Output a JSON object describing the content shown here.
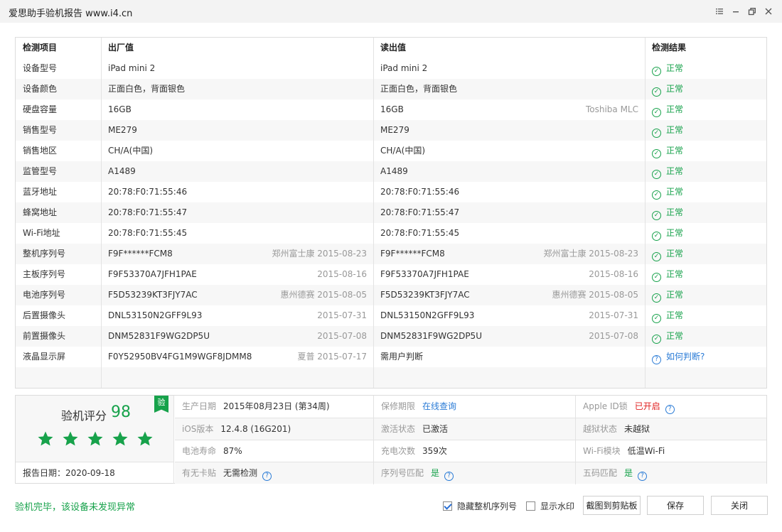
{
  "window": {
    "title": "爱思助手验机报告 www.i4.cn"
  },
  "colors": {
    "ok": "#17a24b",
    "link": "#2a7bd6",
    "alert": "#e02020"
  },
  "table": {
    "headers": [
      "检测项目",
      "出厂值",
      "读出值",
      "检测结果"
    ],
    "rows": [
      {
        "item": "设备型号",
        "factory": "iPad mini 2",
        "factory_note": "",
        "read": "iPad mini 2",
        "read_note": "",
        "result": "正常",
        "status": "ok"
      },
      {
        "item": "设备颜色",
        "factory": "正面白色，背面银色",
        "factory_note": "",
        "read": "正面白色，背面银色",
        "read_note": "",
        "result": "正常",
        "status": "ok"
      },
      {
        "item": "硬盘容量",
        "factory": "16GB",
        "factory_note": "",
        "read": "16GB",
        "read_note": "Toshiba MLC",
        "result": "正常",
        "status": "ok"
      },
      {
        "item": "销售型号",
        "factory": "ME279",
        "factory_note": "",
        "read": "ME279",
        "read_note": "",
        "result": "正常",
        "status": "ok"
      },
      {
        "item": "销售地区",
        "factory": "CH/A(中国)",
        "factory_note": "",
        "read": "CH/A(中国)",
        "read_note": "",
        "result": "正常",
        "status": "ok"
      },
      {
        "item": "监管型号",
        "factory": "A1489",
        "factory_note": "",
        "read": "A1489",
        "read_note": "",
        "result": "正常",
        "status": "ok"
      },
      {
        "item": "蓝牙地址",
        "factory": "20:78:F0:71:55:46",
        "factory_note": "",
        "read": "20:78:F0:71:55:46",
        "read_note": "",
        "result": "正常",
        "status": "ok"
      },
      {
        "item": "蜂窝地址",
        "factory": "20:78:F0:71:55:47",
        "factory_note": "",
        "read": "20:78:F0:71:55:47",
        "read_note": "",
        "result": "正常",
        "status": "ok"
      },
      {
        "item": "Wi-Fi地址",
        "factory": "20:78:F0:71:55:45",
        "factory_note": "",
        "read": "20:78:F0:71:55:45",
        "read_note": "",
        "result": "正常",
        "status": "ok"
      },
      {
        "item": "整机序列号",
        "factory": "F9F******FCM8",
        "factory_note": "郑州富士康 2015-08-23",
        "read": "F9F******FCM8",
        "read_note": "郑州富士康 2015-08-23",
        "result": "正常",
        "status": "ok"
      },
      {
        "item": "主板序列号",
        "factory": "F9F53370A7JFH1PAE",
        "factory_note": "2015-08-16",
        "read": "F9F53370A7JFH1PAE",
        "read_note": "2015-08-16",
        "result": "正常",
        "status": "ok"
      },
      {
        "item": "电池序列号",
        "factory": "F5D53239KT3FJY7AC",
        "factory_note": "惠州德赛 2015-08-05",
        "read": "F5D53239KT3FJY7AC",
        "read_note": "惠州德赛 2015-08-05",
        "result": "正常",
        "status": "ok"
      },
      {
        "item": "后置摄像头",
        "factory": "DNL53150N2GFF9L93",
        "factory_note": "2015-07-31",
        "read": "DNL53150N2GFF9L93",
        "read_note": "2015-07-31",
        "result": "正常",
        "status": "ok"
      },
      {
        "item": "前置摄像头",
        "factory": "DNM52831F9WG2DP5U",
        "factory_note": "2015-07-08",
        "read": "DNM52831F9WG2DP5U",
        "read_note": "2015-07-08",
        "result": "正常",
        "status": "ok"
      },
      {
        "item": "液晶显示屏",
        "factory": "F0Y52950BV4FG1M9WGF8JDMM8",
        "factory_note": "夏普 2015-07-17",
        "read": "需用户判断",
        "read_note": "",
        "result": "如何判断?",
        "status": "question"
      }
    ]
  },
  "summary": {
    "score_label": "验机评分",
    "score": "98",
    "badge": "验",
    "stars": 5,
    "report_date": "报告日期：2020-09-18",
    "fields": [
      {
        "label": "生产日期",
        "value": "2015年08月23日 (第34周)",
        "style": "",
        "help": false
      },
      {
        "label": "保修期限",
        "value": "在线查询",
        "style": "link",
        "help": false
      },
      {
        "label": "Apple ID锁",
        "value": "已开启",
        "style": "red",
        "help": true
      },
      {
        "label": "iOS版本",
        "value": "12.4.8 (16G201)",
        "style": "",
        "help": false
      },
      {
        "label": "激活状态",
        "value": "已激活",
        "style": "",
        "help": false
      },
      {
        "label": "越狱状态",
        "value": "未越狱",
        "style": "",
        "help": false
      },
      {
        "label": "电池寿命",
        "value": "87%",
        "style": "",
        "help": false
      },
      {
        "label": "充电次数",
        "value": "359次",
        "style": "",
        "help": false
      },
      {
        "label": "Wi-Fi模块",
        "value": "低温Wi-Fi",
        "style": "",
        "help": false
      },
      {
        "label": "有无卡贴",
        "value": "无需检测",
        "style": "",
        "help": true
      },
      {
        "label": "序列号匹配",
        "value": "是",
        "style": "green",
        "help": true
      },
      {
        "label": "五码匹配",
        "value": "是",
        "style": "green",
        "help": true
      }
    ]
  },
  "footer": {
    "status": "验机完毕，该设备未发现异常",
    "hide_serial_label": "隐藏整机序列号",
    "hide_serial_checked": true,
    "watermark_label": "显示水印",
    "watermark_checked": false,
    "copy_button": "截图到剪贴板",
    "save_button": "保存",
    "close_button": "关闭"
  }
}
